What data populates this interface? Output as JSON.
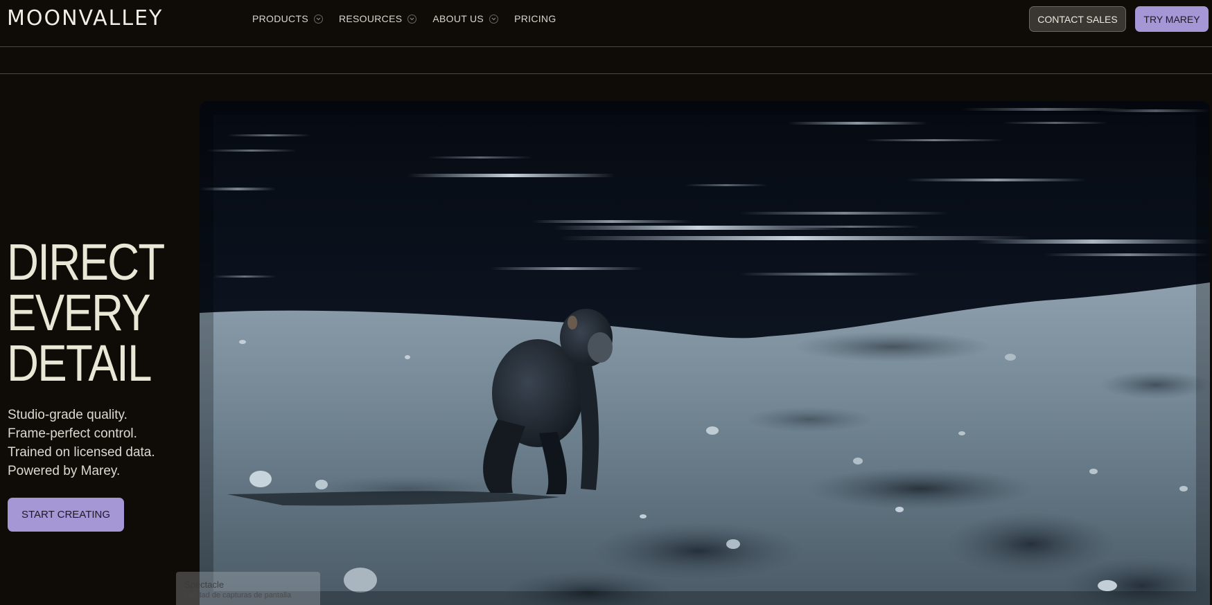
{
  "header": {
    "logo": "MOONVALLEY",
    "nav": [
      {
        "label": "PRODUCTS",
        "has_dropdown": true
      },
      {
        "label": "RESOURCES",
        "has_dropdown": true
      },
      {
        "label": "ABOUT US",
        "has_dropdown": true
      },
      {
        "label": "PRICING",
        "has_dropdown": false
      }
    ],
    "contact_label": "CONTACT SALES",
    "try_label": "TRY MAREY"
  },
  "hero": {
    "title_lines": [
      "DIRECT",
      "EVERY",
      "DETAIL"
    ],
    "sub_lines": [
      "Studio-grade quality.",
      "Frame-perfect control.",
      "Trained on licensed data.",
      "Powered by Marey."
    ],
    "cta_label": "START CREATING"
  },
  "overlay": {
    "title": "Spectacle",
    "subtitle": "Utilidad de capturas de pantalla"
  },
  "colors": {
    "background": "#0f0c08",
    "accent_button": "#a596d6",
    "secondary_button": "#3a3733",
    "text_primary": "#e9e8d6"
  },
  "icons": {
    "nav_dropdown": "chevron-down-icon"
  }
}
